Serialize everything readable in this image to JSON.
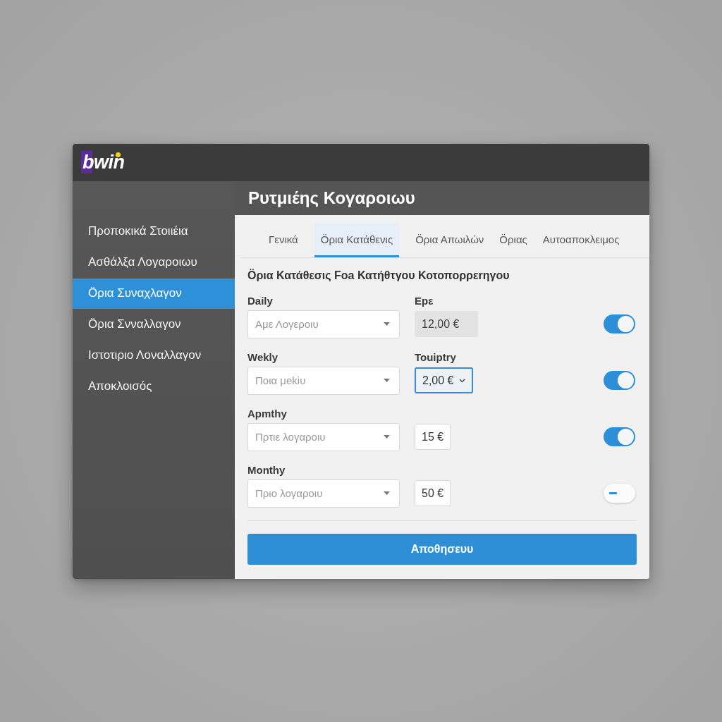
{
  "window": {
    "logo": "bwin"
  },
  "sidebar": {
    "items": [
      {
        "label": "Προποκικά Στοιιέια",
        "selected": false
      },
      {
        "label": "Ασθάλξα Λογαροιωυ",
        "selected": false
      },
      {
        "label": "Öρια Συναχλαγον",
        "selected": true
      },
      {
        "label": "Öρια Σνναλλαγον",
        "selected": false
      },
      {
        "label": "Ιστοτιριο Λοναλλαγον",
        "selected": false
      },
      {
        "label": "Αποκλοισός",
        "selected": false
      }
    ]
  },
  "header": {
    "title": "Ρυτμιέης Κογαροιωυ"
  },
  "tabs": [
    {
      "label": "Γενικά",
      "selected": false
    },
    {
      "label": "Öρια Κατάθενις",
      "selected": true
    },
    {
      "label": "Öρια Απωιλών",
      "selected": false
    },
    {
      "label": "Öριας",
      "selected": false
    },
    {
      "label": "Αυτοαποκλειμος",
      "selected": false
    }
  ],
  "section": {
    "heading": "Öρια Κατάθεσις Fοa Κατήθτγου Κοτοπορρεrηγου"
  },
  "limits": [
    {
      "label": "Daily",
      "select": {
        "placeholder": "Αμε Λογεροιυ"
      },
      "amount_label": "Epε",
      "amount": {
        "kind": "readonly",
        "value": "12,00 €"
      },
      "toggle": {
        "on": true
      }
    },
    {
      "label": "Wekly",
      "select": {
        "placeholder": "Ποια μekiυ"
      },
      "amount_label": "Touiptry",
      "amount": {
        "kind": "dropdown",
        "value": "2,00 €"
      },
      "toggle": {
        "on": true
      }
    },
    {
      "label": "Apmthy",
      "select": {
        "placeholder": "Πρτιε λογαροιυ"
      },
      "amount": {
        "kind": "input",
        "value": "15 €"
      },
      "toggle": {
        "on": true
      }
    },
    {
      "label": "Monthy",
      "select": {
        "placeholder": "Πριο λογαροιυ"
      },
      "amount": {
        "kind": "input",
        "value": "50 €"
      },
      "toggle": {
        "on": false
      }
    }
  ],
  "save_button": "Αποθησευυ"
}
